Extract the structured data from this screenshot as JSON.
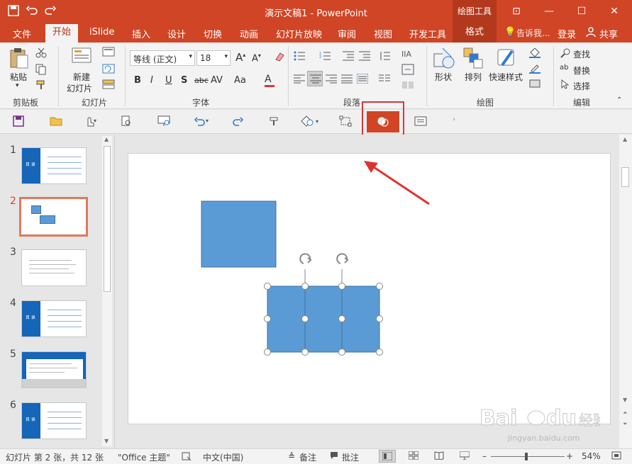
{
  "window": {
    "title": "演示文稿1 - PowerPoint",
    "drawing_tools": "绘图工具"
  },
  "menu": {
    "items": [
      "文件",
      "开始",
      "iSlide",
      "插入",
      "设计",
      "切换",
      "动画",
      "幻灯片放映",
      "审阅",
      "视图",
      "开发工具"
    ],
    "format": "格式",
    "tell_me": "告诉我...",
    "login": "登录",
    "share": "共享"
  },
  "ribbon": {
    "clipboard": {
      "label": "剪贴板",
      "paste": "粘贴"
    },
    "slides": {
      "label": "幻灯片",
      "new_slide_line1": "新建",
      "new_slide_line2": "幻灯片"
    },
    "font": {
      "label": "字体",
      "font_name": "等线 (正文)",
      "font_size": "18"
    },
    "paragraph": {
      "label": "段落"
    },
    "drawing": {
      "label": "绘图",
      "shape": "形状",
      "arrange": "排列",
      "quick_styles": "快速样式"
    },
    "editing": {
      "label": "编辑",
      "find": "查找",
      "replace": "替换",
      "select": "选择"
    }
  },
  "thumbnails": [
    {
      "num": "1",
      "title": "目 录"
    },
    {
      "num": "2",
      "title": ""
    },
    {
      "num": "3",
      "title": ""
    },
    {
      "num": "4",
      "title": "目 录"
    },
    {
      "num": "5",
      "title": ""
    },
    {
      "num": "6",
      "title": "目 录"
    }
  ],
  "status": {
    "slide_info": "幻灯片 第 2 张，共 12 张",
    "theme": "\"Office 主题\"",
    "language": "中文(中国)",
    "notes": "备注",
    "comments": "批注",
    "zoom": "54%"
  },
  "colors": {
    "accent": "#d04525",
    "shape_fill": "#5b9bd5",
    "shape_border": "#41719c",
    "highlight": "#d9383a"
  }
}
